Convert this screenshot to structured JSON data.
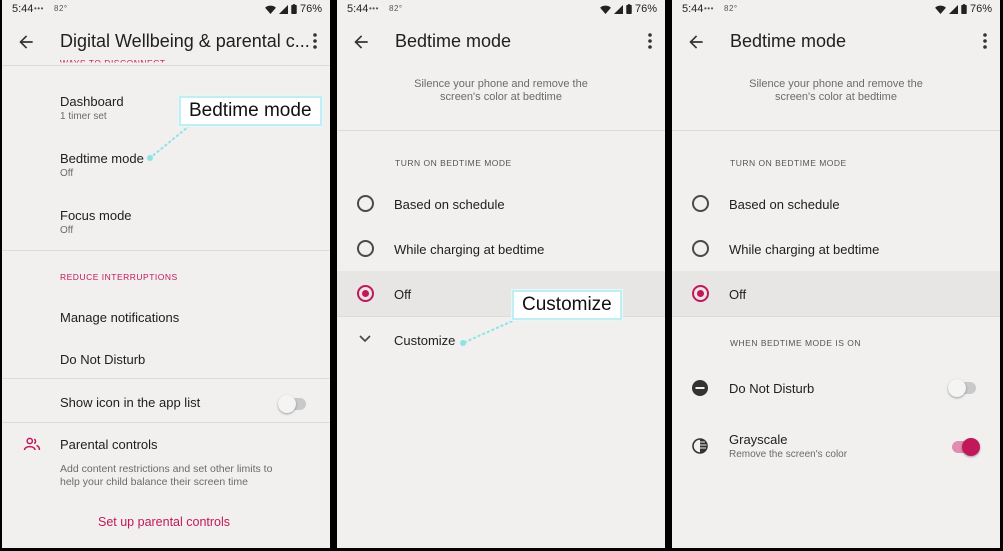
{
  "status": {
    "time": "5:44",
    "temp": "82°",
    "battery": "76%"
  },
  "screen1": {
    "title": "Digital Wellbeing & parental c...",
    "cut_header": "WAYS TO DISCONNECT",
    "dashboard": {
      "title": "Dashboard",
      "sub": "1 timer set"
    },
    "bedtime": {
      "title": "Bedtime mode",
      "sub": "Off"
    },
    "focus": {
      "title": "Focus mode",
      "sub": "Off"
    },
    "reduce_header": "REDUCE INTERRUPTIONS",
    "manage_notifications": "Manage notifications",
    "dnd": "Do Not Disturb",
    "show_icon": {
      "label": "Show icon in the app list",
      "on": false
    },
    "parental": {
      "title": "Parental controls",
      "desc_line1": "Add content restrictions and set other limits to",
      "desc_line2": "help your child balance their screen time",
      "link": "Set up parental controls"
    },
    "callout": "Bedtime mode"
  },
  "screen2": {
    "title": "Bedtime mode",
    "desc_line1": "Silence your phone and remove the",
    "desc_line2": "screen's color at bedtime",
    "turn_on_header": "TURN ON BEDTIME MODE",
    "options": [
      "Based on schedule",
      "While charging at bedtime",
      "Off"
    ],
    "selected": "Off",
    "customize": "Customize",
    "callout": "Customize"
  },
  "screen3": {
    "title": "Bedtime mode",
    "desc_line1": "Silence your phone and remove the",
    "desc_line2": "screen's color at bedtime",
    "turn_on_header": "TURN ON BEDTIME MODE",
    "options": [
      "Based on schedule",
      "While charging at bedtime",
      "Off"
    ],
    "selected": "Off",
    "when_on_header": "WHEN BEDTIME MODE IS ON",
    "dnd": {
      "label": "Do Not Disturb",
      "on": false
    },
    "grayscale": {
      "label": "Grayscale",
      "sub": "Remove the screen's color",
      "on": true
    }
  },
  "colors": {
    "accent": "#c2185b",
    "callout_border": "#bfeff2",
    "background": "#f1f0ef"
  }
}
